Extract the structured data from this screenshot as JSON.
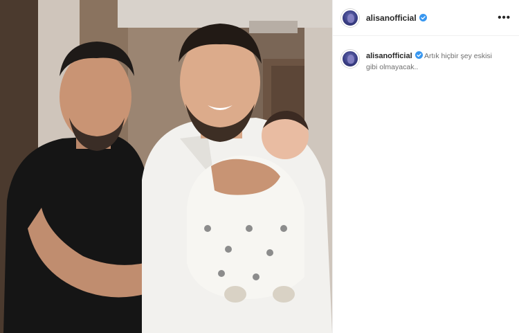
{
  "post": {
    "photo_alt": "Photo of two men, one holding a newborn baby",
    "author": {
      "username": "alisanofficial",
      "verified": true
    },
    "header_more_icon": "more-horizontal-icon",
    "caption": {
      "username": "alisanofficial",
      "text": "Artık hiçbir şey eskisi gibi olmayacak.."
    }
  },
  "colors": {
    "verified_blue": "#3897f0",
    "text_primary": "#262626",
    "divider": "#efefef"
  }
}
